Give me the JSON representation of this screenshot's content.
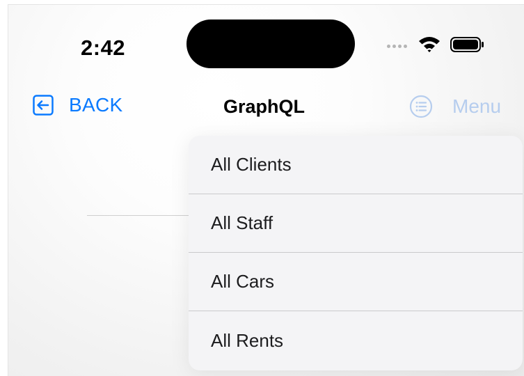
{
  "status_bar": {
    "time": "2:42",
    "icons": [
      "signal-dots-icon",
      "wifi-icon",
      "battery-icon"
    ]
  },
  "nav": {
    "back_label": "BACK",
    "back_icon": "arrow-left-box-icon",
    "title": "GraphQL",
    "menu_label": "Menu",
    "menu_icon": "list-circle-icon"
  },
  "dropdown": {
    "items": [
      {
        "label": "All Clients"
      },
      {
        "label": "All Staff"
      },
      {
        "label": "All Cars"
      },
      {
        "label": "All Rents"
      }
    ]
  },
  "colors": {
    "accent": "#0a7aff",
    "menu_disabled": "#b6cdee",
    "menu_background": "#f4f4f6",
    "separator": "#c9c9cc"
  }
}
